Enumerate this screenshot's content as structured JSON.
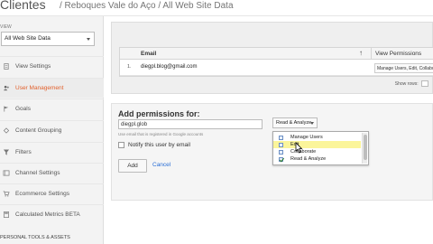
{
  "header": {
    "title": "Clientes",
    "breadcrumb": "/ Reboques Vale do Aço / All Web Site Data"
  },
  "sidebar": {
    "view_label": "VIEW",
    "view_select": "All Web Site Data",
    "items": [
      {
        "label": "View Settings",
        "icon": "document-icon",
        "active": false
      },
      {
        "label": "User Management",
        "icon": "users-icon",
        "active": true
      },
      {
        "label": "Goals",
        "icon": "flag-icon",
        "active": false
      },
      {
        "label": "Content Grouping",
        "icon": "grouping-icon",
        "active": false
      },
      {
        "label": "Filters",
        "icon": "filter-icon",
        "active": false
      },
      {
        "label": "Channel Settings",
        "icon": "channel-icon",
        "active": false
      },
      {
        "label": "Ecommerce Settings",
        "icon": "cart-icon",
        "active": false
      },
      {
        "label": "Calculated Metrics BETA",
        "icon": "calculator-icon",
        "active": false
      }
    ],
    "footer": "PERSONAL TOOLS & ASSETS"
  },
  "users_table": {
    "headers": {
      "email": "Email",
      "permissions": "View Permissions"
    },
    "rows": [
      {
        "num": "1.",
        "email": "diegpl.blog@gmail.com",
        "permissions": "Manage Users, Edit, Collaborate, Re"
      }
    ],
    "show_rows_label": "Show rows:"
  },
  "add_permissions": {
    "title": "Add permissions for:",
    "email_value": "diegpl.glob",
    "helper_text": "Use email that is registered in Google accounts",
    "notify_label": "Notify this user by email",
    "add_label": "Add",
    "cancel_label": "Cancel",
    "dropdown_value": "Read & Analyze",
    "options": [
      {
        "label": "Manage Users",
        "checked": false,
        "highlighted": false
      },
      {
        "label": "Edit",
        "checked": false,
        "highlighted": true
      },
      {
        "label": "Collaborate",
        "checked": false,
        "highlighted": false
      },
      {
        "label": "Read & Analyze",
        "checked": true,
        "highlighted": false
      }
    ]
  },
  "colors": {
    "accent": "#e25f2a",
    "link": "#2a6fd6",
    "highlight": "#fbf59a"
  }
}
